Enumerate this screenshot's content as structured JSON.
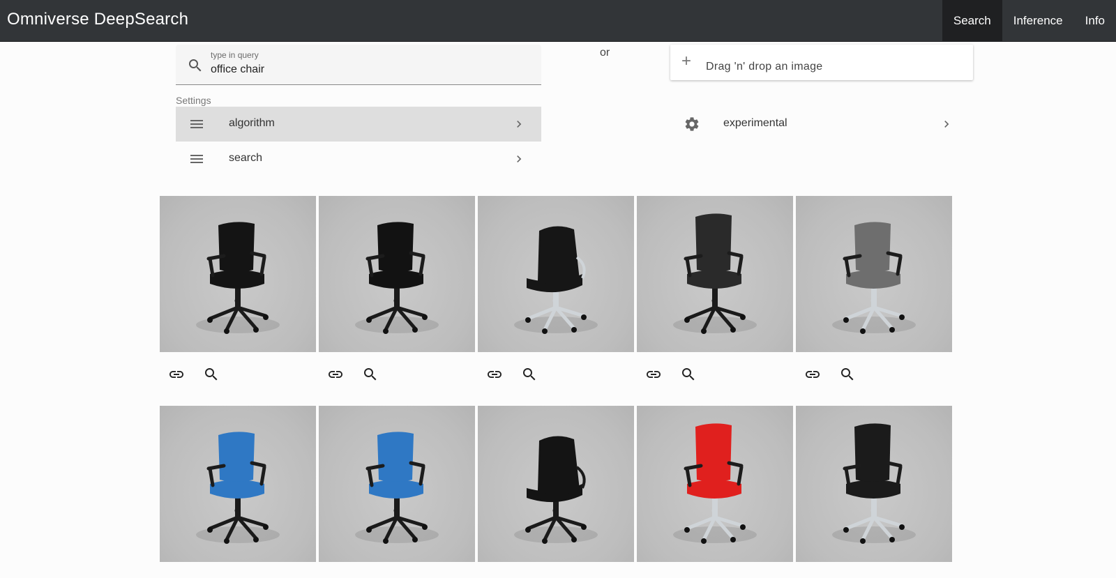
{
  "app": {
    "title": "Omniverse DeepSearch"
  },
  "nav": {
    "tabs": [
      {
        "label": "Search",
        "active": true
      },
      {
        "label": "Inference",
        "active": false
      },
      {
        "label": "Info",
        "active": false
      }
    ]
  },
  "search": {
    "label": "type in query",
    "value": "office chair",
    "icon": "search-icon"
  },
  "separator": "or",
  "dropzone": {
    "label": "Drag 'n' drop an image",
    "icon": "plus-icon"
  },
  "settings": {
    "heading": "Settings",
    "items": [
      {
        "label": "algorithm",
        "icon": "menu-icon",
        "highlighted": true
      },
      {
        "label": "search",
        "icon": "menu-icon",
        "highlighted": false
      }
    ],
    "experimental": {
      "label": "experimental",
      "icon": "gear-icon"
    }
  },
  "results": {
    "actions": [
      "link-icon",
      "zoom-icon"
    ],
    "items": [
      {
        "chair": "black task chair",
        "color": "#141414"
      },
      {
        "chair": "black executive chair",
        "color": "#121212"
      },
      {
        "chair": "black chair back view",
        "color": "#161616"
      },
      {
        "chair": "mesh chair grey seat",
        "color": "#2a2a2a"
      },
      {
        "chair": "grey ergonomic chair",
        "color": "#6e6e6e"
      },
      {
        "chair": "blue task chair",
        "color": "#2f78c4"
      },
      {
        "chair": "blue task chair",
        "color": "#2f78c4"
      },
      {
        "chair": "black chair back view",
        "color": "#141414"
      },
      {
        "chair": "red high-back chair",
        "color": "#e0201e"
      },
      {
        "chair": "black high-back chair",
        "color": "#1b1b1b"
      }
    ]
  },
  "colors": {
    "topbar": "#323538",
    "active_tab": "#1f2022",
    "highlight_row": "#dedede"
  }
}
